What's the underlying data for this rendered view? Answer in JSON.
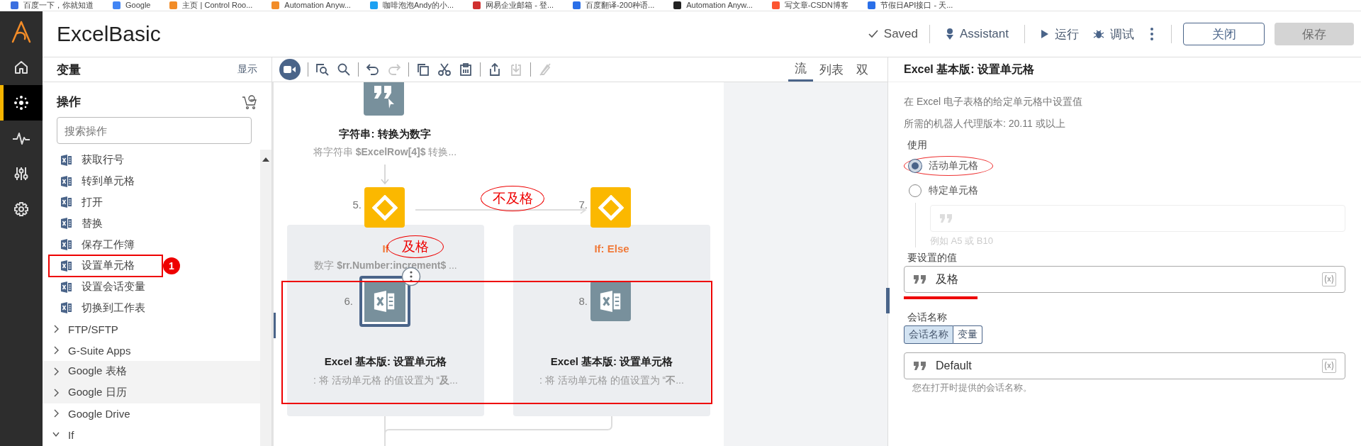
{
  "bookmarks": [
    {
      "label": "百度一下，你就知道",
      "color": "#3b6fe0"
    },
    {
      "label": "Google",
      "color": "#4285f4"
    },
    {
      "label": "主页 | Control Roo...",
      "color": "#f28c28"
    },
    {
      "label": "Automation Anyw...",
      "color": "#f28c28"
    },
    {
      "label": "咖啡泡泡Andy的小...",
      "color": "#1da1f2"
    },
    {
      "label": "网易企业邮箱 - 登...",
      "color": "#d0302f"
    },
    {
      "label": "百度翻译-200种语...",
      "color": "#2a6fe8"
    },
    {
      "label": "Automation Anyw...",
      "color": "#222222"
    },
    {
      "label": "写文章-CSDN博客",
      "color": "#fc5531"
    },
    {
      "label": "节假日API接口 - 天...",
      "color": "#2a6fe8"
    }
  ],
  "nav": [
    {
      "kind": "home",
      "selected": false
    },
    {
      "kind": "bots",
      "selected": true
    },
    {
      "kind": "activity",
      "selected": false
    },
    {
      "kind": "devices",
      "selected": false
    },
    {
      "kind": "settings",
      "selected": false
    }
  ],
  "header": {
    "title": "ExcelBasic",
    "saved": "Saved",
    "assistant": "Assistant",
    "run": "运行",
    "debug": "调试",
    "close": "关闭",
    "save": {
      "label": "保存",
      "disabled": true
    }
  },
  "variables": {
    "title": "变量",
    "toggle": "显示"
  },
  "actions": {
    "title": "操作",
    "search": {
      "placeholder": "搜索操作"
    },
    "items": [
      {
        "kind": "action",
        "label": "获取行号",
        "highlighted": false
      },
      {
        "kind": "action",
        "label": "转到单元格",
        "highlighted": false
      },
      {
        "kind": "action",
        "label": "打开",
        "highlighted": false
      },
      {
        "kind": "action",
        "label": "替换",
        "highlighted": false
      },
      {
        "kind": "action",
        "label": "保存工作簿",
        "highlighted": false
      },
      {
        "kind": "action",
        "label": "设置单元格",
        "highlighted": false,
        "callout": "1"
      },
      {
        "kind": "action",
        "label": "设置会话变量",
        "highlighted": false
      },
      {
        "kind": "action",
        "label": "切换到工作表",
        "highlighted": false
      },
      {
        "kind": "group",
        "label": "FTP/SFTP",
        "highlighted": false,
        "expanded": false
      },
      {
        "kind": "group",
        "label": "G-Suite Apps",
        "highlighted": false,
        "expanded": false
      },
      {
        "kind": "group",
        "label": "Google 表格",
        "highlighted": true,
        "expanded": false
      },
      {
        "kind": "group",
        "label": "Google 日历",
        "highlighted": true,
        "expanded": false
      },
      {
        "kind": "group",
        "label": "Google Drive",
        "highlighted": false,
        "expanded": false
      },
      {
        "kind": "group",
        "label": "If",
        "highlighted": false,
        "expanded": true
      }
    ]
  },
  "toolbar": [
    {
      "kind": "record"
    },
    {
      "kind": "sep"
    },
    {
      "kind": "fit",
      "disabled": false
    },
    {
      "kind": "search",
      "disabled": false
    },
    {
      "kind": "sep"
    },
    {
      "kind": "undo",
      "disabled": false
    },
    {
      "kind": "redo",
      "disabled": true
    },
    {
      "kind": "sep"
    },
    {
      "kind": "copy",
      "disabled": false
    },
    {
      "kind": "cut",
      "disabled": false
    },
    {
      "kind": "paste",
      "disabled": false
    },
    {
      "kind": "sep"
    },
    {
      "kind": "export",
      "disabled": false
    },
    {
      "kind": "import",
      "disabled": true
    },
    {
      "kind": "sep"
    },
    {
      "kind": "disable",
      "disabled": true
    }
  ],
  "view_tabs": [
    {
      "label": "流",
      "selected": true
    },
    {
      "label": "列表",
      "selected": false
    },
    {
      "label": "双",
      "selected": false
    }
  ],
  "flow": {
    "step": {
      "title": "字符串: 转换为数字",
      "desc": "将字符串 **$ExcelRow[4]$** 转换..."
    },
    "edge_label": "不及格",
    "frame": true,
    "branches": [
      {
        "number": "5.",
        "title": "If",
        "annotation": "及格",
        "desc": "数字 **$rr.Number:increment$** ...",
        "child": {
          "number": "6.",
          "title": "Excel 基本版: 设置单元格",
          "desc": ": 将 活动单元格 的值设置为 “**及**...",
          "selected": true
        }
      },
      {
        "number": "7.",
        "title": "If: Else",
        "child": {
          "number": "8.",
          "title": "Excel 基本版: 设置单元格",
          "desc": ": 将 活动单元格 的值设置为 “**不**...",
          "selected": false
        }
      }
    ]
  },
  "properties": {
    "title": "Excel 基本版: 设置单元格",
    "description": "在 Excel 电子表格的给定单元格中设置值",
    "requirement": "所需的机器人代理版本: 20.11 或以上",
    "use": {
      "label": "使用",
      "options": [
        {
          "label": "活动单元格",
          "selected": true,
          "circled": true
        },
        {
          "label": "特定单元格",
          "selected": false,
          "circled": false
        }
      ],
      "cell_hint": "例如 A5 或 B10"
    },
    "value": {
      "label": "要设置的值",
      "value": "及格",
      "underlined": true
    },
    "session": {
      "label": "会话名称",
      "modes": [
        {
          "label": "会话名称",
          "selected": true
        },
        {
          "label": "变量",
          "selected": false
        }
      ],
      "value": "Default",
      "hint": "您在打开时提供的会话名称。"
    }
  }
}
